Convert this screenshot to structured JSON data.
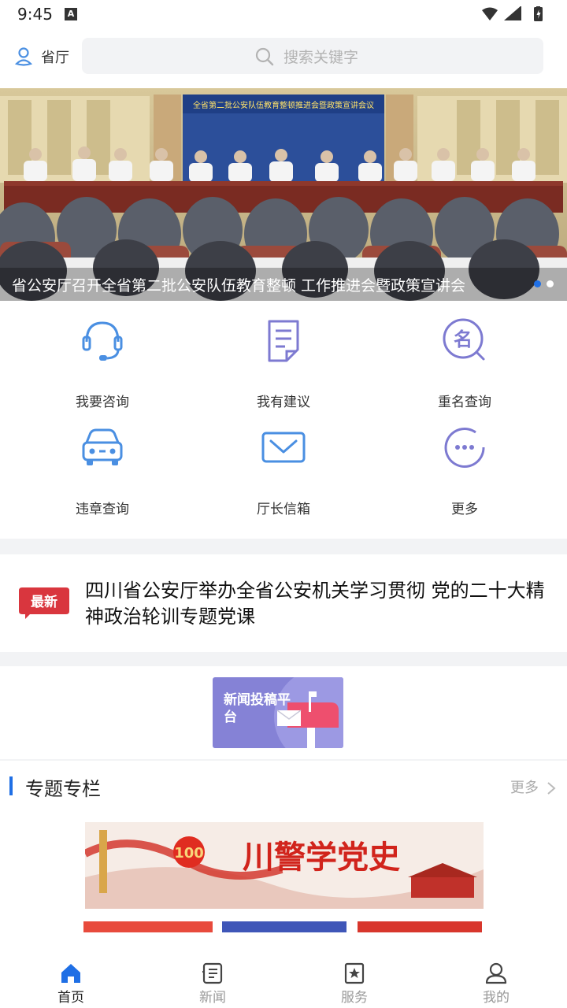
{
  "status_bar": {
    "time": "9:45",
    "a_badge": "A"
  },
  "header": {
    "location_label": "省厅",
    "search_placeholder": "搜索关键字"
  },
  "banner": {
    "caption": "省公安厅召开全省第二批公安队伍教育整顿 工作推进会暨政策宣讲会",
    "backdrop_text": "全省第二批公安队伍教育整顿推进会暨政策宣讲会议",
    "slide_count": 2,
    "active_slide": 1
  },
  "services": [
    {
      "label": "我要咨询",
      "icon": "headset-icon"
    },
    {
      "label": "我有建议",
      "icon": "document-icon"
    },
    {
      "label": "重名查询",
      "icon": "name-search-icon"
    },
    {
      "label": "违章查询",
      "icon": "car-icon"
    },
    {
      "label": "厅长信箱",
      "icon": "mail-icon"
    },
    {
      "label": "更多",
      "icon": "more-icon"
    }
  ],
  "latest_news": {
    "badge": "最新",
    "title": "四川省公安厅举办全省公安机关学习贯彻 党的二十大精神政治轮训专题党课"
  },
  "submit_platform": {
    "label": "新闻投稿平台"
  },
  "topics": {
    "title": "专题专栏",
    "more": "更多",
    "banner_text": "川警学党史",
    "banner_badge": "100"
  },
  "tabs": [
    {
      "label": "首页",
      "icon": "home-icon",
      "active": true
    },
    {
      "label": "新闻",
      "icon": "news-icon",
      "active": false
    },
    {
      "label": "服务",
      "icon": "service-icon",
      "active": false
    },
    {
      "label": "我的",
      "icon": "user-icon",
      "active": false
    }
  ],
  "colors": {
    "accent": "#1f6fe5",
    "icon_blue": "#4a8fe2",
    "icon_purple": "#7d7ad1",
    "badge_red": "#d9363e",
    "inactive_gray": "#999999"
  }
}
